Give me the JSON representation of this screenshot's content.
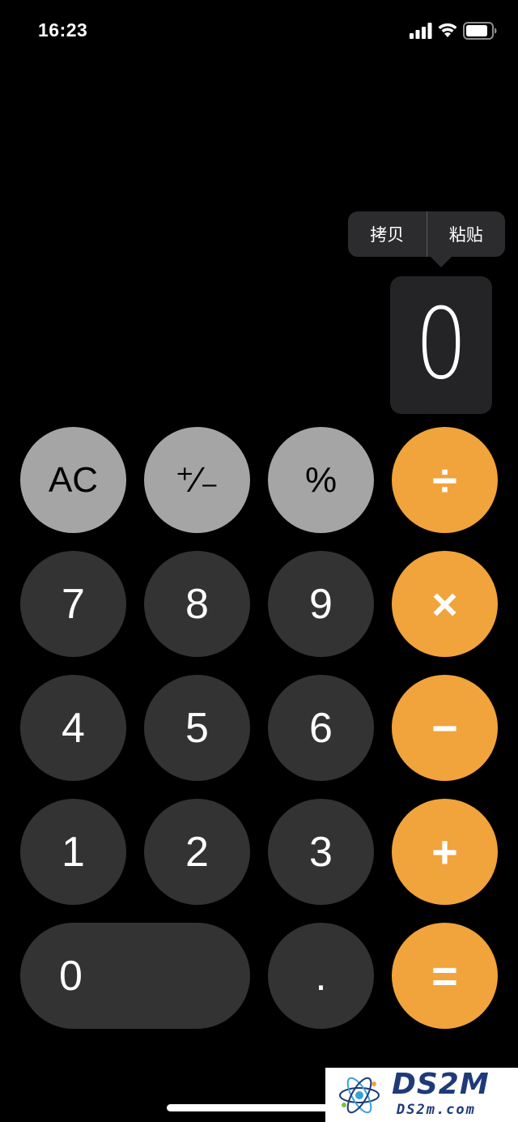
{
  "status_bar": {
    "time": "16:23",
    "icons": [
      "signal-icon",
      "wifi-icon",
      "battery-icon"
    ]
  },
  "edit_menu": {
    "items": [
      {
        "label": "拷贝"
      },
      {
        "label": "粘贴"
      }
    ]
  },
  "display": {
    "value": "0"
  },
  "keypad": {
    "rows": [
      [
        {
          "label": "AC",
          "style": "gray"
        },
        {
          "label": "⁺∕₋",
          "style": "gray"
        },
        {
          "label": "%",
          "style": "gray"
        },
        {
          "label": "÷",
          "style": "orange"
        }
      ],
      [
        {
          "label": "7",
          "style": "dark"
        },
        {
          "label": "8",
          "style": "dark"
        },
        {
          "label": "9",
          "style": "dark"
        },
        {
          "label": "×",
          "style": "orange"
        }
      ],
      [
        {
          "label": "4",
          "style": "dark"
        },
        {
          "label": "5",
          "style": "dark"
        },
        {
          "label": "6",
          "style": "dark"
        },
        {
          "label": "−",
          "style": "orange"
        }
      ],
      [
        {
          "label": "1",
          "style": "dark"
        },
        {
          "label": "2",
          "style": "dark"
        },
        {
          "label": "3",
          "style": "dark"
        },
        {
          "label": "+",
          "style": "orange"
        }
      ],
      [
        {
          "label": "0",
          "style": "dark"
        },
        {
          "label": ".",
          "style": "dark"
        },
        {
          "label": "=",
          "style": "orange"
        }
      ]
    ]
  },
  "colors": {
    "background": "#000000",
    "function_key": "#a5a5a5",
    "digit_key": "#333333",
    "operator_key": "#f1a33c",
    "menu": "#2c2c2e"
  },
  "watermark": {
    "brand": "DS2M",
    "url": "DS2m.com"
  }
}
